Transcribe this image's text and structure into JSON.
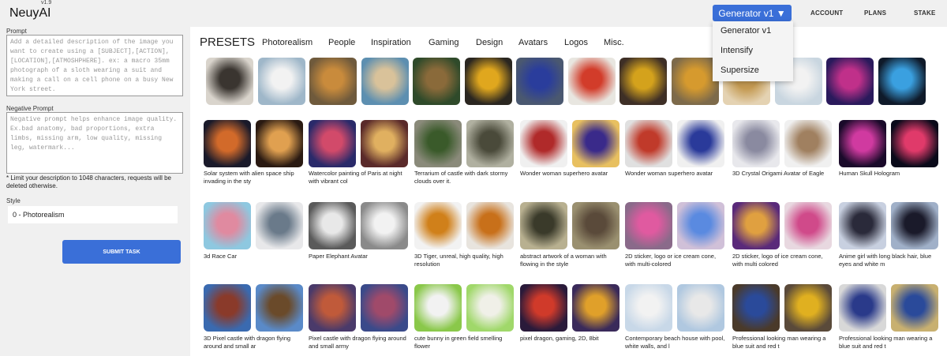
{
  "header": {
    "logo": "NeuyAI",
    "version": "v1.9",
    "generator_button": "Generator v1 ▼",
    "nav": [
      "ACCOUNT",
      "PLANS",
      "STAKE"
    ]
  },
  "generator_menu": [
    "Generator v1",
    "Intensify",
    "Supersize"
  ],
  "form": {
    "prompt_label": "Prompt",
    "prompt_placeholder": "Add a detailed description of the image you want to create using a [SUBJECT],[ACTION],[LOCATION],[ATMOSHPHERE]. ex: a macro 35mm photograph of a sloth wearing a suit and making a call on a cell phone on a busy New York street.",
    "negative_label": "Negative Prompt",
    "negative_placeholder": "Negative prompt helps enhance image quality. Ex.bad anatomy, bad proportions, extra limbs, missing arm, low quality, missing leg, watermark...",
    "limit_note": "* Limit your description to 1048 characters, requests will be deleted otherwise.",
    "style_label": "Style",
    "style_value": "0 - Photorealism",
    "submit": "SUBMIT TASK"
  },
  "presets": {
    "title": "PRESETS",
    "tabs": [
      "Photorealism",
      "People",
      "Inspiration",
      "Gaming",
      "Design",
      "Avatars",
      "Logos",
      "Misc."
    ],
    "top_row": [
      {
        "name": "preset-interior",
        "c1": "#d9d4cc",
        "c2": "#3a3530"
      },
      {
        "name": "preset-polar-bear",
        "c1": "#9fb7c9",
        "c2": "#f2f2f2"
      },
      {
        "name": "preset-tiger",
        "c1": "#6f5a3c",
        "c2": "#c98b3c"
      },
      {
        "name": "preset-boy-bubble",
        "c1": "#5d8fb0",
        "c2": "#d9c29a"
      },
      {
        "name": "preset-joker",
        "c1": "#2f4a2a",
        "c2": "#8a6a3a"
      },
      {
        "name": "preset-sports-car",
        "c1": "#2a2620",
        "c2": "#e0a71e"
      },
      {
        "name": "preset-woman-blue",
        "c1": "#4a5870",
        "c2": "#2a3d9c"
      },
      {
        "name": "preset-chair",
        "c1": "#e8e6e0",
        "c2": "#d23c2a"
      },
      {
        "name": "preset-man-car",
        "c1": "#3e2f26",
        "c2": "#d4a21c"
      },
      {
        "name": "preset-flower",
        "c1": "#7d6a4a",
        "c2": "#d69a2e"
      },
      {
        "name": "preset-woman-gold",
        "c1": "#e4d2b2",
        "c2": "#c49a52"
      },
      {
        "name": "preset-house",
        "c1": "#c9d6e0",
        "c2": "#f2f2f2"
      },
      {
        "name": "preset-dragon-neon",
        "c1": "#2a1a5c",
        "c2": "#c0308a"
      },
      {
        "name": "preset-motorbike",
        "c1": "#0f1a2a",
        "c2": "#3aa0e0"
      }
    ],
    "cards": [
      {
        "caption": "Solar system with alien space ship invading in the sty",
        "c": [
          "#1a1a2a",
          "#d26a2a",
          "#2a1a12",
          "#e0a050"
        ]
      },
      {
        "caption": "Watercolor painting of Paris at night with vibrant col",
        "c": [
          "#2a2a6a",
          "#d24a6a",
          "#5a2a2a",
          "#e0b060"
        ]
      },
      {
        "caption": "Terrarium of castle with dark stormy clouds over it.",
        "c": [
          "#8a8a7a",
          "#3a5a2a",
          "#b0b0a0",
          "#4a4a3a"
        ]
      },
      {
        "caption": "Wonder woman superhero avatar",
        "c": [
          "#f0f0f0",
          "#b02a2a",
          "#e8c060",
          "#3a2a8a"
        ]
      },
      {
        "caption": "Wonder woman superhero avatar",
        "c": [
          "#e0e0e0",
          "#c03a2a",
          "#f0f0f0",
          "#2a3a9a"
        ]
      },
      {
        "caption": "3D Crystal Origami Avatar of Eagle",
        "c": [
          "#e8e8ec",
          "#8a8aa0",
          "#f0f0f0",
          "#a08060"
        ]
      },
      {
        "caption": "Human Skull Hologram",
        "c": [
          "#1a0a2a",
          "#d03aa0",
          "#0a0a1a",
          "#e03a6a"
        ]
      },
      {
        "caption": "3d Race Car",
        "c": [
          "#8ec8e0",
          "#e08aa0",
          "#e8e8ea",
          "#6a7a8a"
        ]
      },
      {
        "caption": "Paper Elephant Avatar",
        "c": [
          "#5a5a5a",
          "#e8e8e8",
          "#8a8a8a",
          "#f2f2f2"
        ]
      },
      {
        "caption": "3D Tiger, unreal, high quality, high resolution",
        "c": [
          "#f2f2f2",
          "#d0801a",
          "#e8e4de",
          "#c8701a"
        ]
      },
      {
        "caption": "abstract artwork of a woman with flowing in the style",
        "c": [
          "#b8b090",
          "#3a3a2a",
          "#9a9070",
          "#5a4a3a"
        ]
      },
      {
        "caption": "2D sticker, logo or ice cream cone, with multi-colored",
        "c": [
          "#8a6a8a",
          "#e05aa0",
          "#d0c0d8",
          "#5a8ae0"
        ]
      },
      {
        "caption": "2D sticker, logo of ice cream cone, with multi colored",
        "c": [
          "#5a2a7a",
          "#e0a040",
          "#e8d8e0",
          "#d04a8a"
        ]
      },
      {
        "caption": "Anime girl with long black hair, blue eyes and white m",
        "c": [
          "#c8d0e0",
          "#2a2a3a",
          "#a0b0c8",
          "#1a1a2a"
        ]
      },
      {
        "caption": "3D Pixel castle with dragon flying around and small ar",
        "c": [
          "#3a6ab0",
          "#8a3a2a",
          "#5a8ac8",
          "#6a4a2a"
        ]
      },
      {
        "caption": "Pixel castle with dragon flying around and small army",
        "c": [
          "#4a3a6a",
          "#c05a3a",
          "#3a4a8a",
          "#a04a6a"
        ]
      },
      {
        "caption": "cute bunny in green field smelling flower",
        "c": [
          "#8ac84a",
          "#f2f2f2",
          "#a0d86a",
          "#f0f0e8"
        ]
      },
      {
        "caption": "pixel dragon, gaming, 2D, 8bit",
        "c": [
          "#2a1a3a",
          "#d03a2a",
          "#3a2a5a",
          "#e0a02a"
        ]
      },
      {
        "caption": "Contemporary beach house with pool, white walls, and l",
        "c": [
          "#c8d8e8",
          "#f2f2f2",
          "#b0c8e0",
          "#e8e8e8"
        ]
      },
      {
        "caption": "Professional looking man wearing a blue suit and red t",
        "c": [
          "#4a3a2a",
          "#2a4a9a",
          "#5a4a3a",
          "#e0b020"
        ]
      },
      {
        "caption": "Professional looking man wearing a blue suit and red t",
        "c": [
          "#d8d8d8",
          "#2a3a8a",
          "#c8b070",
          "#2a4a9a"
        ]
      }
    ]
  }
}
